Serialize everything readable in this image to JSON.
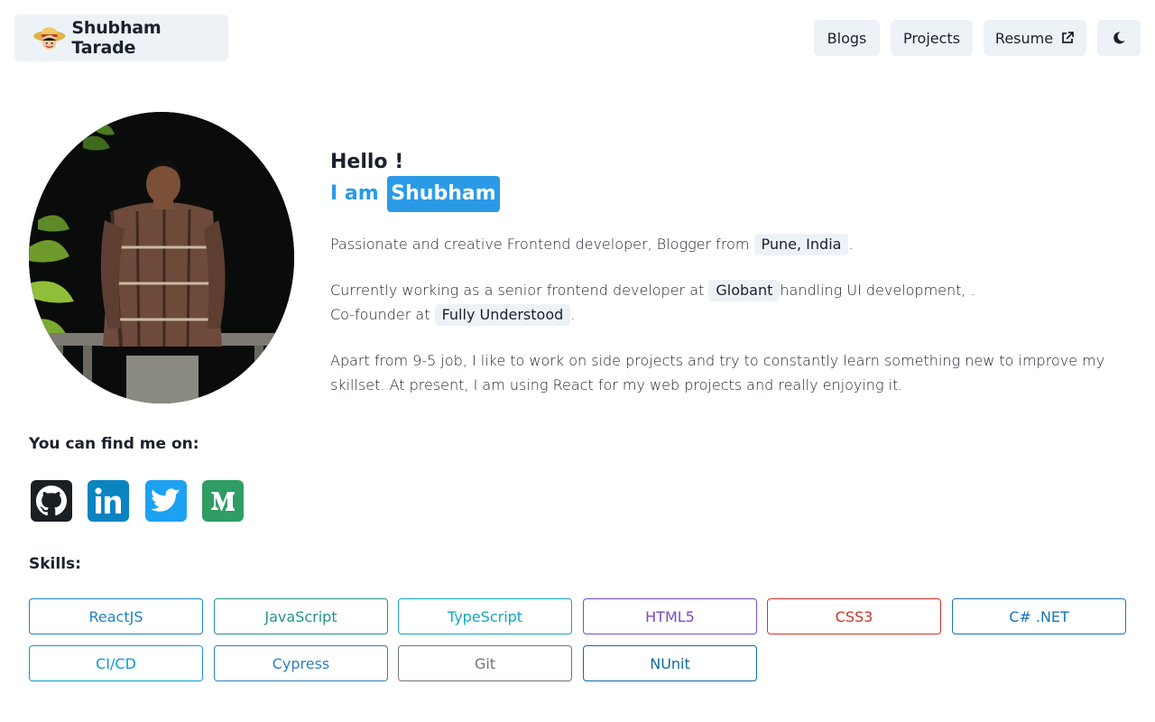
{
  "header": {
    "brand_name": "Shubham Tarade",
    "nav": {
      "blogs": "Blogs",
      "projects": "Projects",
      "resume": "Resume"
    }
  },
  "hero": {
    "hello": "Hello !",
    "iam_prefix": "I am",
    "iam_name": "Shubham",
    "p1_text": "Passionate and creative Frontend developer, Blogger from",
    "p1_chip": "Pune, India",
    "p1_end": ".",
    "p2_text": "Currently working as a senior frontend developer at",
    "p2_chip": "Globant",
    "p2_after": "handling UI development, .",
    "p2b_text": "Co-founder at",
    "p2b_chip": "Fully Understood",
    "p2b_end": ".",
    "p3_text": "Apart from 9-5 job, I like to work on side projects and try to constantly learn something new to improve my skillset. At present, I am using React for my web projects and really enjoying it."
  },
  "find": {
    "title": "You can find me on:",
    "icons": [
      "github-icon",
      "linkedin-icon",
      "twitter-icon",
      "medium-icon"
    ]
  },
  "skills": {
    "title": "Skills:",
    "items": [
      {
        "label": "ReactJS",
        "color": "#1e84c4"
      },
      {
        "label": "JavaScript",
        "color": "#22928c"
      },
      {
        "label": "TypeScript",
        "color": "#14a6bf"
      },
      {
        "label": "HTML5",
        "color": "#7b4bc6"
      },
      {
        "label": "CSS3",
        "color": "#d0322f"
      },
      {
        "label": "C# .NET",
        "color": "#1673b8"
      },
      {
        "label": "CI/CD",
        "color": "#0d9bcf"
      },
      {
        "label": "Cypress",
        "color": "#2f7fc1"
      },
      {
        "label": "Git",
        "color": "#6d7480"
      },
      {
        "label": "NUnit",
        "color": "#0e6aa3"
      }
    ]
  },
  "colors": {
    "accent": "#2b9ae6",
    "chip_bg": "#edf2f7",
    "text": "#1a202c"
  }
}
